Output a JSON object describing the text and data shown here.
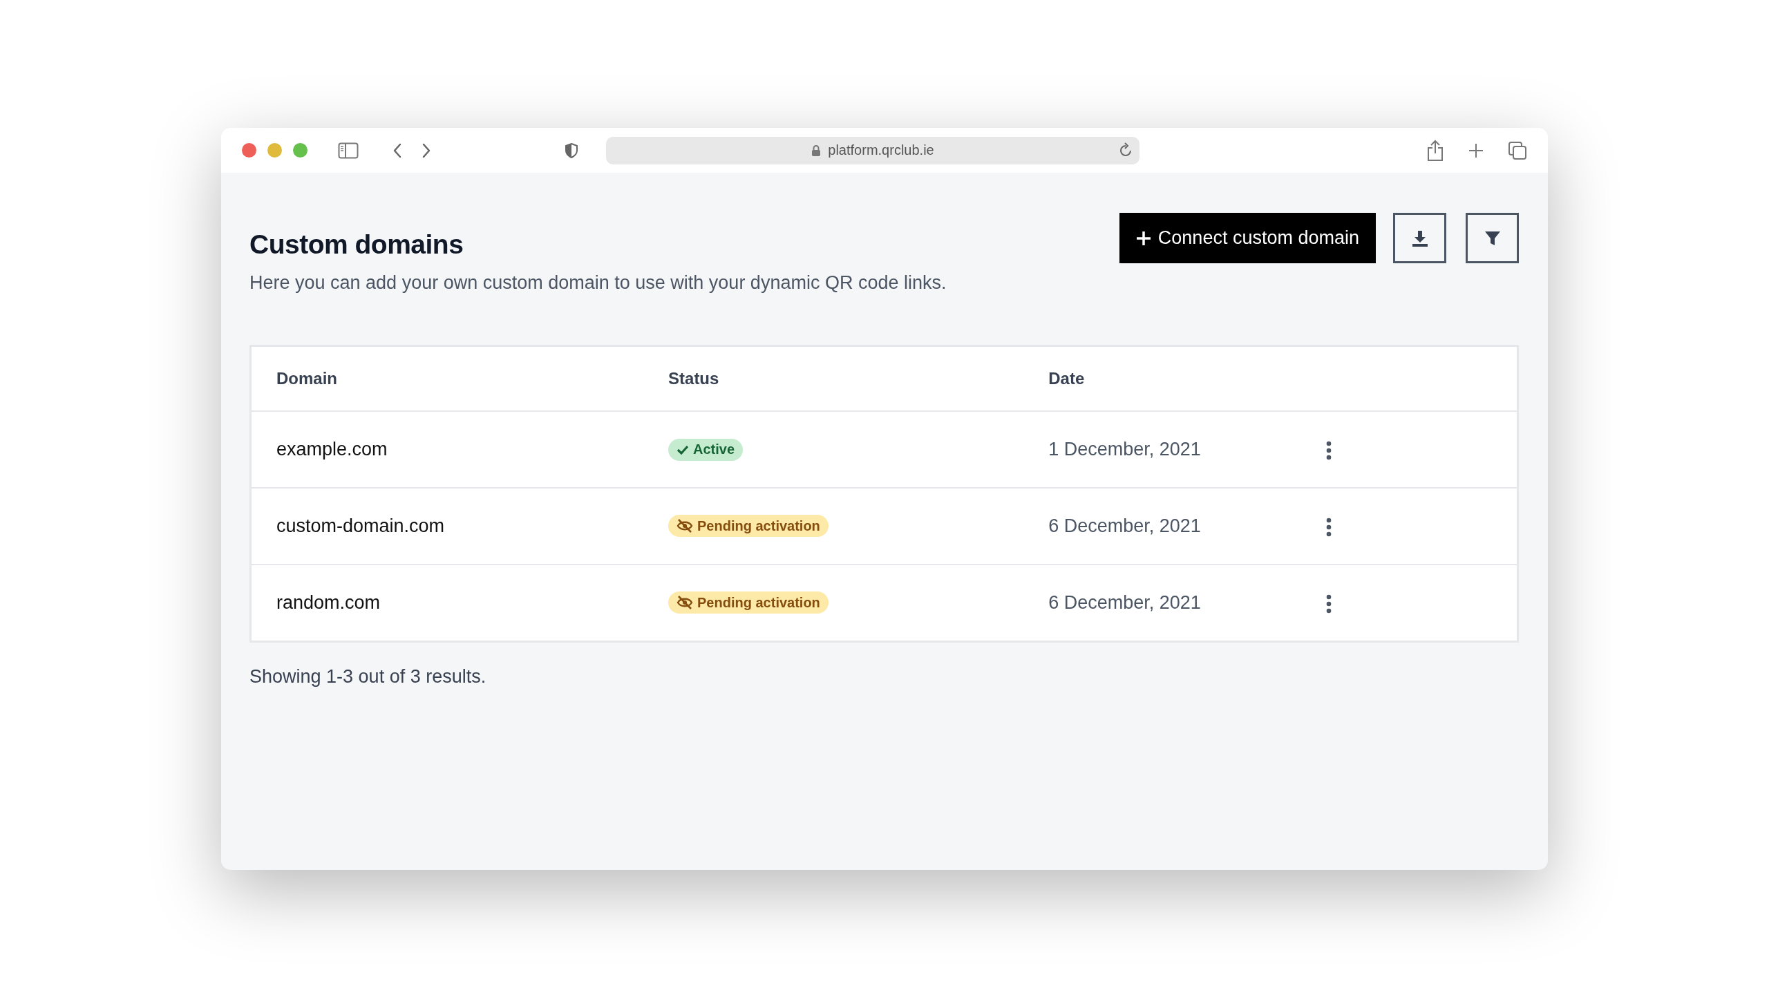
{
  "browser": {
    "url": "platform.qrclub.ie"
  },
  "page": {
    "title": "Custom domains",
    "subtitle": "Here you can add your own custom domain to use with your dynamic QR code links.",
    "connect_button": "Connect custom domain"
  },
  "table": {
    "columns": [
      "Domain",
      "Status",
      "Date"
    ],
    "rows": [
      {
        "domain": "example.com",
        "status": {
          "kind": "active",
          "label": "Active"
        },
        "date": "1 December, 2021"
      },
      {
        "domain": "custom-domain.com",
        "status": {
          "kind": "pending",
          "label": "Pending activation"
        },
        "date": "6 December, 2021"
      },
      {
        "domain": "random.com",
        "status": {
          "kind": "pending",
          "label": "Pending activation"
        },
        "date": "6 December, 2021"
      }
    ]
  },
  "footer": "Showing 1-3 out of 3 results."
}
